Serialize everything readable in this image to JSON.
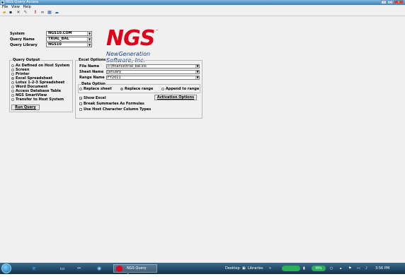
{
  "window": {
    "title": "NGS Query Access"
  },
  "menu": [
    "File",
    "View",
    "Help"
  ],
  "toolbar": {
    "icons": [
      "open-folder-icon",
      "save-icon",
      "delete-icon",
      "edit-icon",
      "run-icon",
      "binoculars-icon",
      "table-icon",
      "cloud-icon"
    ]
  },
  "query": {
    "system_label": "System",
    "system_value": "NGS10.COM",
    "query_name_label": "Query Name",
    "query_name_value": "TRIAL_BAL",
    "library_label": "Query Library",
    "library_value": "NGS10"
  },
  "logo": {
    "big": "NGS",
    "tm": "™",
    "line1": "NewGeneration",
    "line2": "Software, Inc."
  },
  "query_output": {
    "legend": "Query Output",
    "options": [
      {
        "label": "As Defined on Host System",
        "selected": false
      },
      {
        "label": "Screen",
        "selected": false
      },
      {
        "label": "Printer",
        "selected": false
      },
      {
        "label": "Excel Spreadsheet",
        "selected": true
      },
      {
        "label": "Lotus 1-2-3 Spreadsheet",
        "selected": false
      },
      {
        "label": "Word Document",
        "selected": false
      },
      {
        "label": "Access Database Table",
        "selected": false
      },
      {
        "label": "NGS SmartView",
        "selected": false
      },
      {
        "label": "Transfer to Host System",
        "selected": false
      }
    ],
    "run_button": "Run Query"
  },
  "excel_options": {
    "legend": "Excel Options",
    "file_name_label": "File Name",
    "file_name_value": "c:\\finance\\trial_bal.xls",
    "sheet_name_label": "Sheet Name",
    "sheet_name_value": "January",
    "range_name_label": "Range Name",
    "range_name_value": "FY2011",
    "data_option_legend": "Data Option",
    "data_options": [
      {
        "label": "Replace sheet",
        "selected": false
      },
      {
        "label": "Replace range",
        "selected": true
      },
      {
        "label": "Append to range",
        "selected": false
      }
    ],
    "show_excel_label": "Show Excel",
    "show_excel_checked": true,
    "activation_button": "Activation Options",
    "break_summaries_label": "Break Summaries As Formulas",
    "break_summaries_checked": false,
    "host_char_label": "Use Host Character Column Types",
    "host_char_checked": false
  },
  "taskbar": {
    "task_label": "NGS Query Access",
    "desktop_label": "Desktop",
    "libraries_label": "Libraries",
    "battery": "99%",
    "clock": "3:56 PM"
  },
  "colors": {
    "accent": "#e1001a",
    "brand_blue": "#1b3f8b",
    "taskbar": "#1f4a6b"
  }
}
